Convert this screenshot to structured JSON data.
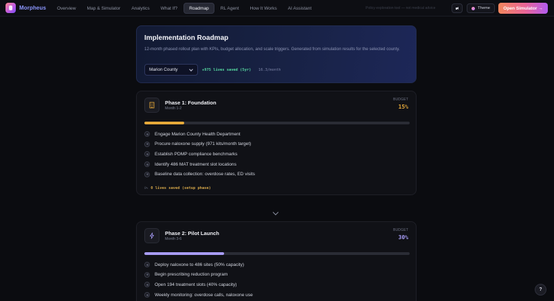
{
  "nav": {
    "brand": "Morpheus",
    "links": [
      {
        "label": "Overview"
      },
      {
        "label": "Map & Simulator"
      },
      {
        "label": "Analytics"
      },
      {
        "label": "What If?"
      },
      {
        "label": "Roadmap",
        "active": true
      },
      {
        "label": "RL Agent"
      },
      {
        "label": "How It Works"
      },
      {
        "label": "AI Assistant"
      }
    ],
    "disclaimer": "Policy exploration tool — not medical advice",
    "theme_label": "Theme",
    "cta_label": "Open Simulator →"
  },
  "hero": {
    "title": "Implementation Roadmap",
    "description": "12-month phased rollout plan with KPIs, budget allocation, and scale triggers. Generated from simulation results for the selected county.",
    "county": "Marion County",
    "lives_saved": "+975 lives saved (5yr)",
    "per_month": "16.3/month"
  },
  "phases": [
    {
      "title": "Phase 1: Foundation",
      "period": "Month 1-2",
      "budget_label": "BUDGET",
      "budget": "15%",
      "accent": "#e6a93a",
      "progress": 0.15,
      "tasks": [
        "Engage Marion County Health Department",
        "Procure naloxone supply (971 kits/month target)",
        "Establish PDMP compliance benchmarks",
        "Identify 486 MAT treatment slot locations",
        "Baseline data collection: overdose rates, ED visits"
      ],
      "footer_pct": "0%",
      "footer_text": "0 lives saved (setup phase)"
    },
    {
      "title": "Phase 2: Pilot Launch",
      "period": "Month 3-6",
      "budget_label": "BUDGET",
      "budget": "30%",
      "accent": "#a89cf7",
      "progress": 0.3,
      "tasks": [
        "Deploy naloxone to 486 sites (50% capacity)",
        "Begin prescribing reduction program",
        "Open 194 treatment slots (40% capacity)",
        "Weekly monitoring: overdose calls, naloxone use"
      ]
    }
  ],
  "help_label": "?"
}
